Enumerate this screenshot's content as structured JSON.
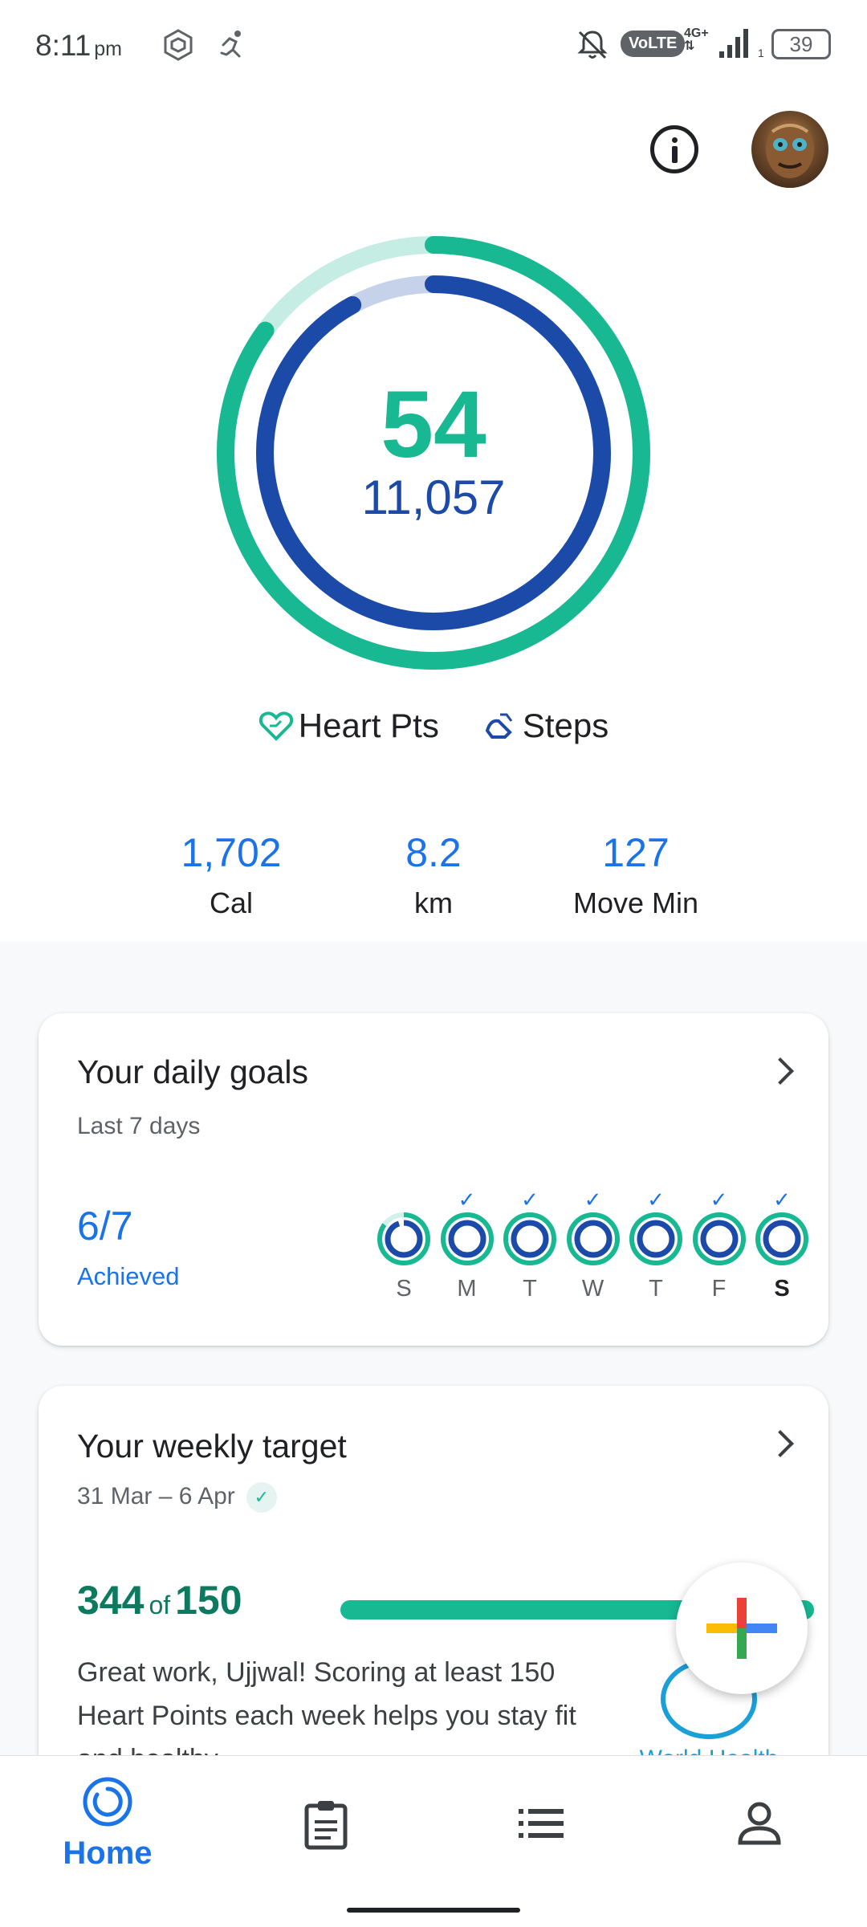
{
  "status_bar": {
    "time": "8:11",
    "time_suffix": "pm",
    "volte": "VoLTE",
    "network": "4G+",
    "sim_slot": "1",
    "battery": "39"
  },
  "ring": {
    "heart_points": "54",
    "steps": "11,057",
    "heart_fill_fraction": 0.85,
    "steps_fill_fraction": 0.92,
    "heart_color": "#17b892",
    "steps_color": "#1c4aa8"
  },
  "legend": {
    "heart_pts": "Heart Pts",
    "steps": "Steps"
  },
  "stats": [
    {
      "value": "1,702",
      "label": "Cal"
    },
    {
      "value": "8.2",
      "label": "km"
    },
    {
      "value": "127",
      "label": "Move Min"
    }
  ],
  "daily_goals": {
    "title": "Your daily goals",
    "subtitle": "Last 7 days",
    "count": "6/7",
    "achieved_label": "Achieved",
    "days": [
      {
        "label": "S",
        "achieved": false,
        "today": false,
        "heart_fill": 0.85,
        "steps_fill": 0.95
      },
      {
        "label": "M",
        "achieved": true,
        "today": false,
        "heart_fill": 1.0,
        "steps_fill": 1.0
      },
      {
        "label": "T",
        "achieved": true,
        "today": false,
        "heart_fill": 1.0,
        "steps_fill": 1.0
      },
      {
        "label": "W",
        "achieved": true,
        "today": false,
        "heart_fill": 1.0,
        "steps_fill": 1.0
      },
      {
        "label": "T",
        "achieved": true,
        "today": false,
        "heart_fill": 1.0,
        "steps_fill": 1.0
      },
      {
        "label": "F",
        "achieved": true,
        "today": false,
        "heart_fill": 1.0,
        "steps_fill": 1.0
      },
      {
        "label": "S",
        "achieved": true,
        "today": true,
        "heart_fill": 1.0,
        "steps_fill": 1.0
      }
    ]
  },
  "weekly_target": {
    "title": "Your weekly target",
    "date_range": "31 Mar – 6 Apr",
    "score": "344",
    "of": "of",
    "target": "150",
    "message": "Great work, Ujjwal! Scoring at least 150 Heart Points each week helps you stay fit and healthy.",
    "org_name": "World Health Organization"
  },
  "bottom_nav": {
    "home_label": "Home"
  },
  "colors": {
    "accent_blue": "#1a73e8",
    "heart_green": "#17b892"
  }
}
